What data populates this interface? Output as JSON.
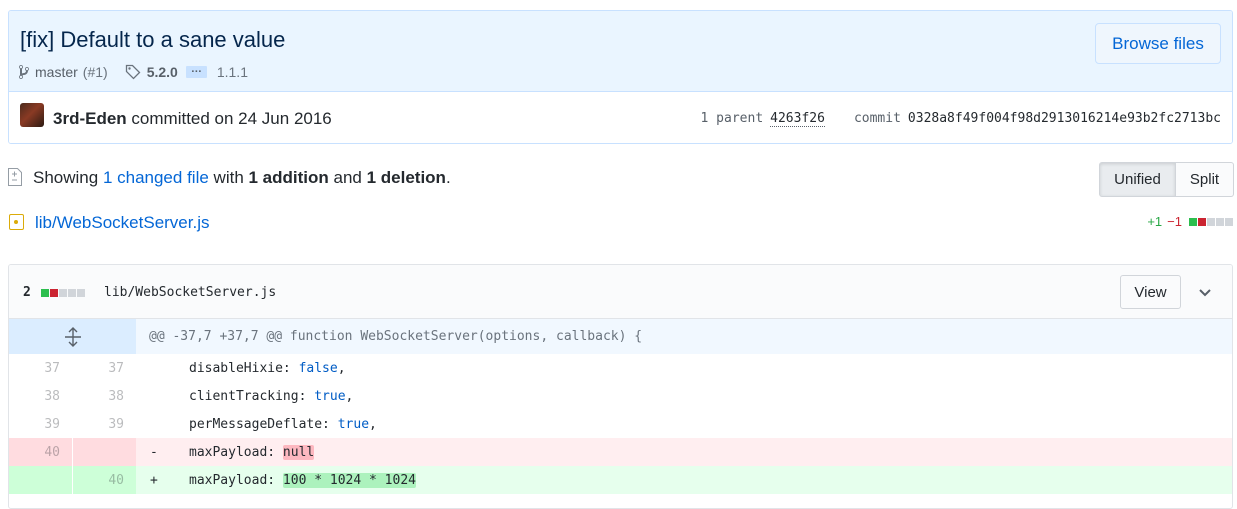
{
  "commit": {
    "title": "[fix] Default to a sane value",
    "branch": "master",
    "pr": "(#1)",
    "tag": "5.2.0",
    "ellipsis": "…",
    "tag_other": "1.1.1",
    "browse_label": "Browse files",
    "author": "3rd-Eden",
    "committed_text": " committed on 24 Jun 2016",
    "parent_label": "1 parent",
    "parent_sha": "4263f26",
    "commit_label": "commit",
    "commit_sha": "0328a8f49f004f98d2913016214e93b2fc2713bc"
  },
  "toc": {
    "showing": "Showing ",
    "changed": "1 changed file",
    "with": " with ",
    "additions": "1 addition",
    "and": " and ",
    "deletions": "1 deletion",
    "period": ".",
    "unified_label": "Unified",
    "split_label": "Split"
  },
  "file_list": {
    "path": "lib/WebSocketServer.js",
    "additions": "+1",
    "deletions": "−1"
  },
  "file": {
    "count": "2",
    "path": "lib/WebSocketServer.js",
    "view_label": "View",
    "hunk": "@@ -37,7 +37,7 @@ function WebSocketServer(options, callback) {",
    "lines": [
      {
        "old": "37",
        "new": "37",
        "marker": "",
        "key": "disableHixie: ",
        "value": "false",
        "end": ","
      },
      {
        "old": "38",
        "new": "38",
        "marker": "",
        "key": "clientTracking: ",
        "value": "true",
        "end": ","
      },
      {
        "old": "39",
        "new": "39",
        "marker": "",
        "key": "perMessageDeflate: ",
        "value": "true",
        "end": ","
      },
      {
        "old": "40",
        "new": "",
        "marker": "-",
        "key": "maxPayload: ",
        "value": "null",
        "end": ""
      },
      {
        "old": "",
        "new": "40",
        "marker": "+",
        "key": "maxPayload: ",
        "value": "100 * 1024 * 1024",
        "end": ""
      }
    ]
  },
  "colors": {
    "link": "#0366d6",
    "added": "#28a745",
    "deleted": "#cb2431",
    "header_bg": "#eaf5ff"
  }
}
